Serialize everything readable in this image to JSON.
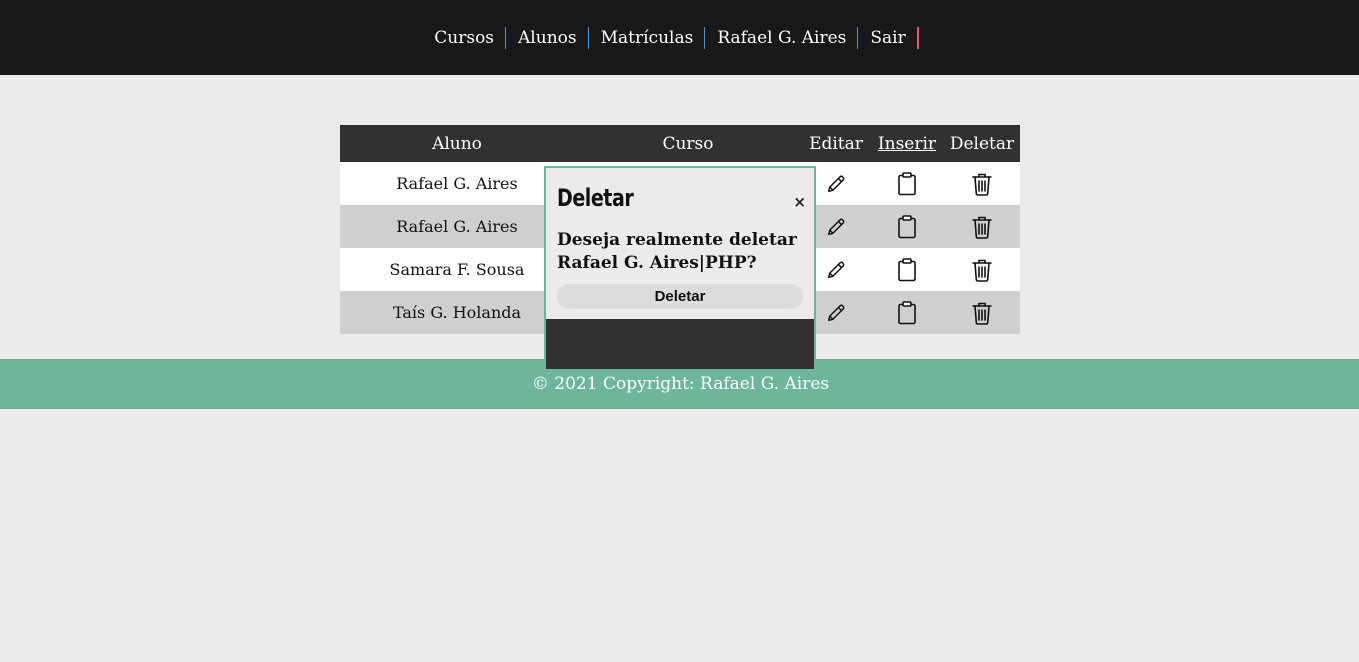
{
  "nav": {
    "items": [
      {
        "label": "Cursos"
      },
      {
        "label": "Alunos"
      },
      {
        "label": "Matrículas"
      },
      {
        "label": "Rafael G. Aires"
      },
      {
        "label": "Sair"
      }
    ]
  },
  "table": {
    "headers": {
      "aluno": "Aluno",
      "curso": "Curso",
      "editar": "Editar",
      "inserir": "Inserir",
      "deletar": "Deletar"
    },
    "rows": [
      {
        "aluno": "Rafael G. Aires",
        "curso": ""
      },
      {
        "aluno": "Rafael G. Aires",
        "curso": ""
      },
      {
        "aluno": "Samara F. Sousa",
        "curso": ""
      },
      {
        "aluno": "Taís G. Holanda",
        "curso": ""
      }
    ]
  },
  "modal": {
    "title": "Deletar",
    "close_icon": "×",
    "message": "Deseja realmente deletar Rafael G. Aires|PHP?",
    "button_label": "Deletar"
  },
  "footer": {
    "copyright": "© 2021 Copyright: Rafael G. Aires"
  },
  "colors": {
    "nav_bg": "#181818",
    "header_bg": "#313131",
    "accent": "#6db59b",
    "nav_separator": "#4a90d9",
    "nav_last_separator": "#e05b63"
  }
}
